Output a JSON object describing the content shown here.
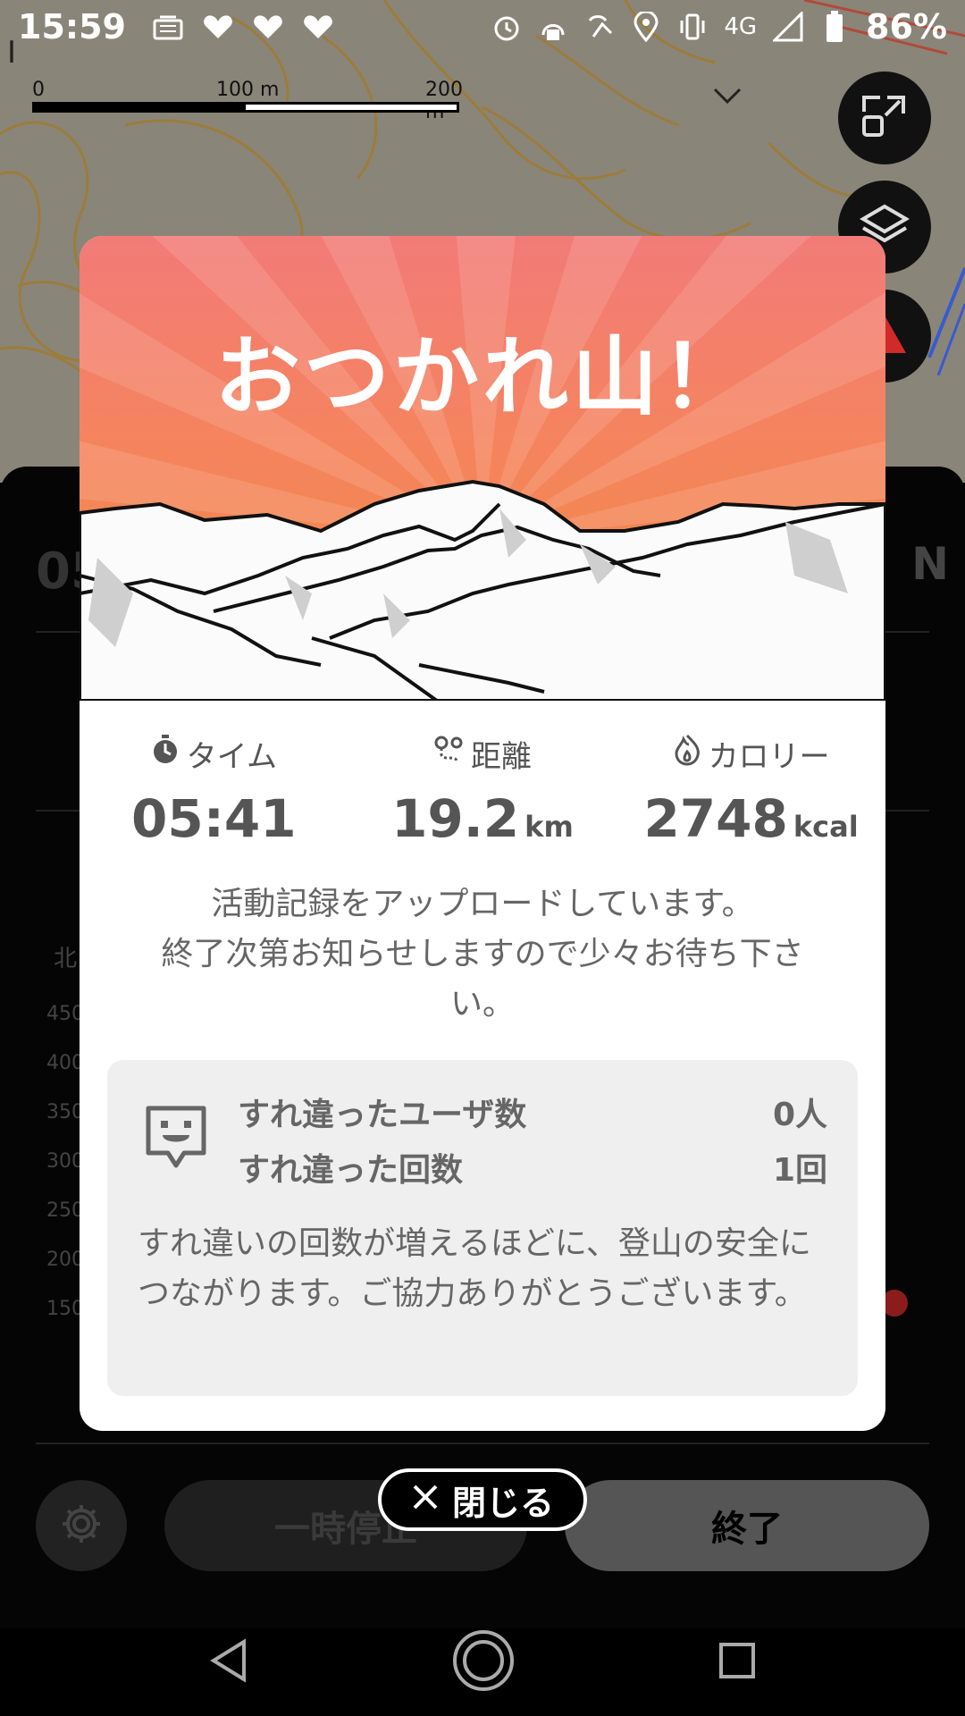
{
  "status_bar": {
    "time": "15:59",
    "battery": "86%",
    "network": "4G"
  },
  "map": {
    "scale": {
      "zero": "0",
      "mid": "100 m",
      "max": "200 m"
    }
  },
  "background_sheet": {
    "time_partial": "05",
    "compass_letter": "N",
    "kita": "北",
    "axis_labels": [
      "450",
      "400",
      "350",
      "300",
      "250",
      "200",
      "150"
    ],
    "settings_icon": "gear-icon",
    "pause_label": "一時停止",
    "end_label": "終了"
  },
  "modal": {
    "title": "おつかれ山！",
    "stats": {
      "time": {
        "label": "タイム",
        "value": "05:41",
        "icon": "stopwatch-icon"
      },
      "distance": {
        "label": "距離",
        "value": "19.2",
        "unit": "km",
        "icon": "route-icon"
      },
      "calories": {
        "label": "カロリー",
        "value": "2748",
        "unit": "kcal",
        "icon": "flame-icon"
      }
    },
    "upload_message_1": "活動記録をアップロードしています。",
    "upload_message_2": "終了次第お知らせしますので少々お待ち下さい。",
    "encounter": {
      "users_label": "すれ違ったユーザ数",
      "users_value": "0人",
      "count_label": "すれ違った回数",
      "count_value": "1回",
      "note": "すれ違いの回数が増えるほどに、登山の安全につながります。ご協力ありがとうございます。"
    }
  },
  "close_button": {
    "label": "閉じる"
  }
}
